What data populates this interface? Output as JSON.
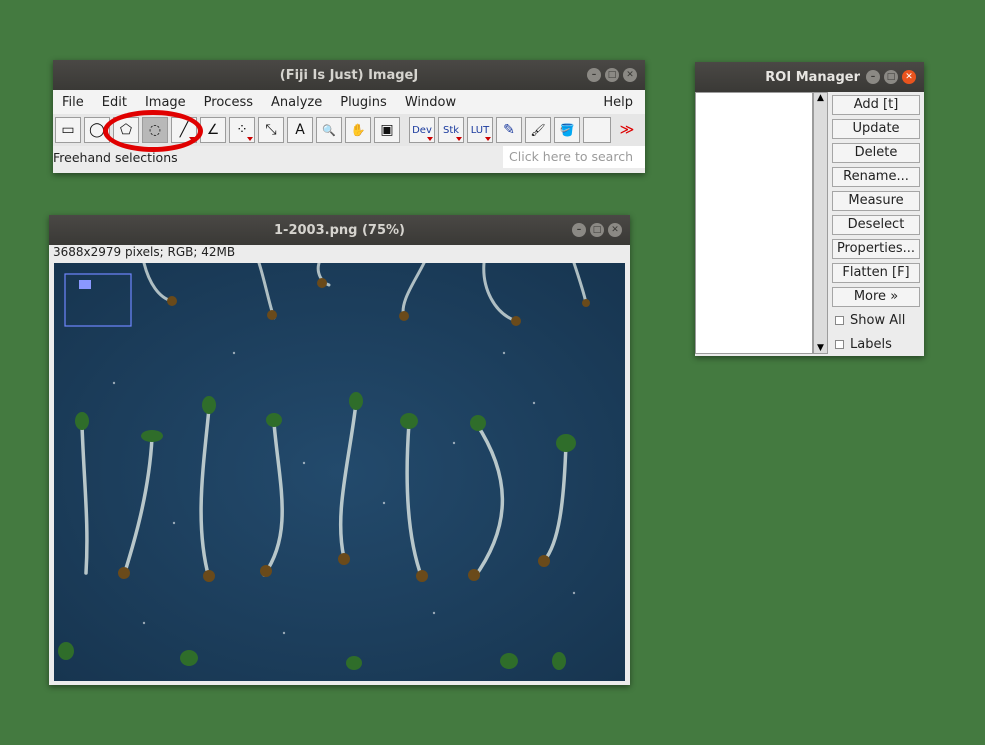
{
  "imagej": {
    "title": "(Fiji Is Just) ImageJ",
    "menus": [
      "File",
      "Edit",
      "Image",
      "Process",
      "Analyze",
      "Plugins",
      "Window",
      "Help"
    ],
    "tools": {
      "rect": "▭",
      "oval": "◯",
      "polygon": "⬠",
      "freehand": "◌",
      "line": "╱",
      "angle": "∠",
      "multipoint": "⁘",
      "wand": "⤡",
      "text": "A",
      "zoom": "🔍",
      "hand": "✋",
      "dropper": "▣",
      "dev": "Dev",
      "stk": "Stk",
      "lut": "LUT",
      "pencil": "✎",
      "brush": "🖌",
      "fill": "🪣",
      "more": "≫"
    },
    "status": "Freehand selections",
    "search_placeholder": "Click here to search"
  },
  "image_window": {
    "title": "1-2003.png (75%)",
    "info": "3688x2979 pixels; RGB; 42MB"
  },
  "roi_manager": {
    "title": "ROI Manager",
    "buttons": [
      "Add [t]",
      "Update",
      "Delete",
      "Rename...",
      "Measure",
      "Deselect",
      "Properties...",
      "Flatten [F]",
      "More »"
    ],
    "checkboxes": [
      "Show All",
      "Labels"
    ]
  },
  "colors": {
    "desktop": "#447a40",
    "annotation": "#e00000",
    "image_background": "#1e4262"
  }
}
